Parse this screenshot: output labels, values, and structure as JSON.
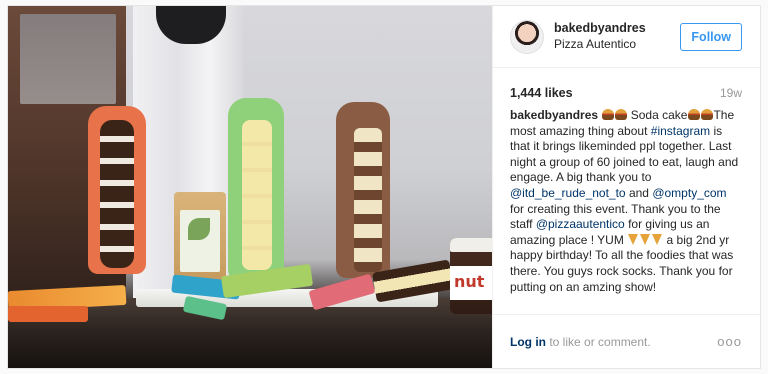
{
  "post": {
    "username": "bakedbyandres",
    "location": "Pizza Autentico",
    "follow_label": "Follow",
    "likes": "1,444 likes",
    "age": "19w",
    "caption": {
      "p1": "Soda cake",
      "p2": "The most amazing thing about",
      "tag": "#instagram",
      "p3": "is that it brings likeminded ppl together. Last night a group of 60 joined to eat, laugh and engage. A big thank you to",
      "mention1": "@itd_be_rude_not_to",
      "p4": "and",
      "mention2": "@ompty_com",
      "p5": "for creating this event. Thank you to the staff",
      "mention3": "@pizzaautentico",
      "p6": "for giving us an amazing place ! YUM",
      "p7": "a big 2nd yr happy birthday! To all the foodies that was there. You guys rock socks. Thank you for putting on an amzing show!"
    },
    "footer": {
      "login_link": "Log in",
      "login_text": " to like or comment.",
      "more": "ooo"
    },
    "photo_label": "nut"
  }
}
